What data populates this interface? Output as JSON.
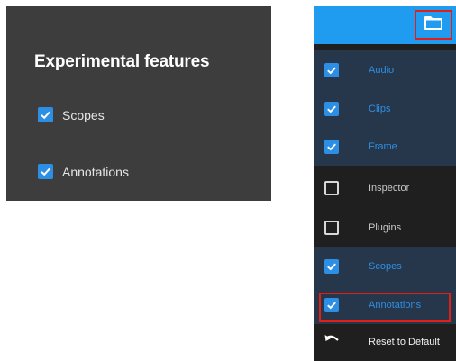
{
  "experimental": {
    "title": "Experimental features",
    "items": [
      {
        "label": "Scopes",
        "checked": true
      },
      {
        "label": "Annotations",
        "checked": true
      }
    ]
  },
  "menu": {
    "header_icon": "folder-icon",
    "items": [
      {
        "label": "Audio",
        "checked": true
      },
      {
        "label": "Clips",
        "checked": true
      },
      {
        "label": "Frame",
        "checked": true
      },
      {
        "label": "Inspector",
        "checked": false
      },
      {
        "label": "Plugins",
        "checked": false
      },
      {
        "label": "Scopes",
        "checked": true
      },
      {
        "label": "Annotations",
        "checked": true
      }
    ],
    "reset_label": "Reset to Default"
  },
  "colors": {
    "accent": "#2d8fe3",
    "header": "#1f9bf0",
    "highlight": "#e31e14",
    "panel_dark": "#3d3d3d",
    "menu_bg": "#1f1f1f",
    "checked_row": "#26374b"
  }
}
